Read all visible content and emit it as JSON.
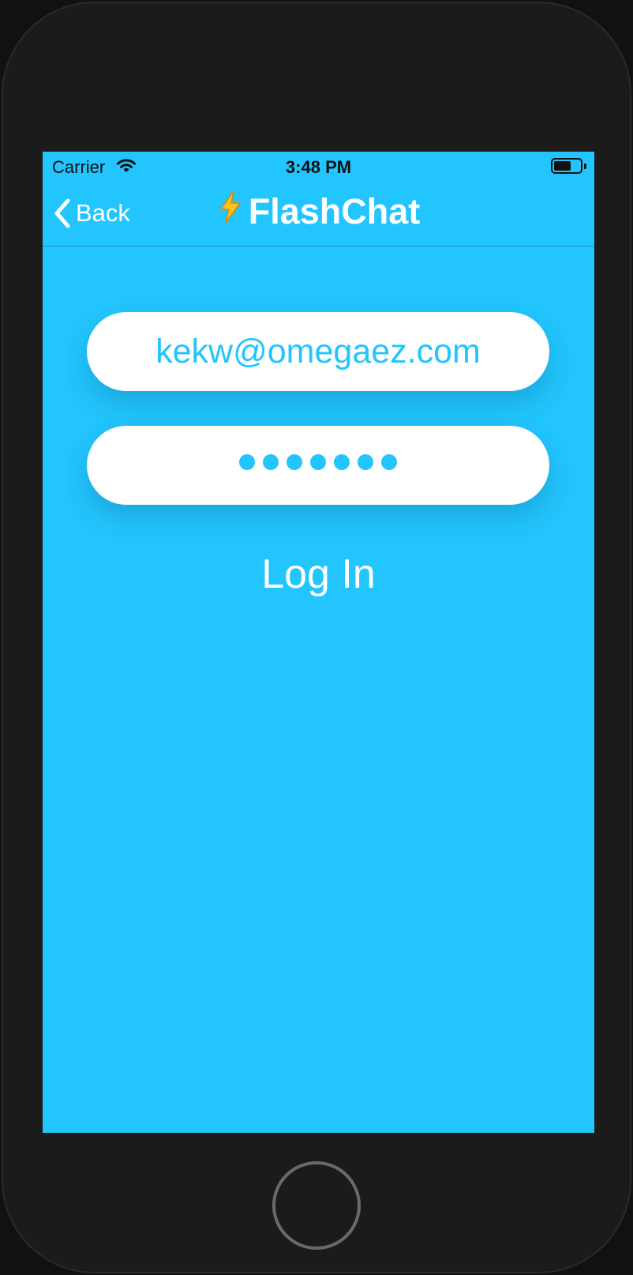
{
  "status_bar": {
    "carrier": "Carrier",
    "time": "3:48 PM",
    "battery_level": 0.65
  },
  "nav": {
    "back_label": "Back",
    "title": "FlashChat"
  },
  "form": {
    "email_value": "kekw@omegaez.com",
    "password_mask_count": 7,
    "login_label": "Log In"
  },
  "colors": {
    "accent": "#22c5fd",
    "text_light": "#ffffff",
    "device_frame": "#1b1b1b"
  },
  "icons": {
    "wifi": "wifi-icon",
    "battery": "battery-icon",
    "back": "chevron-left-icon",
    "title": "lightning-bolt-icon",
    "home": "home-button"
  }
}
